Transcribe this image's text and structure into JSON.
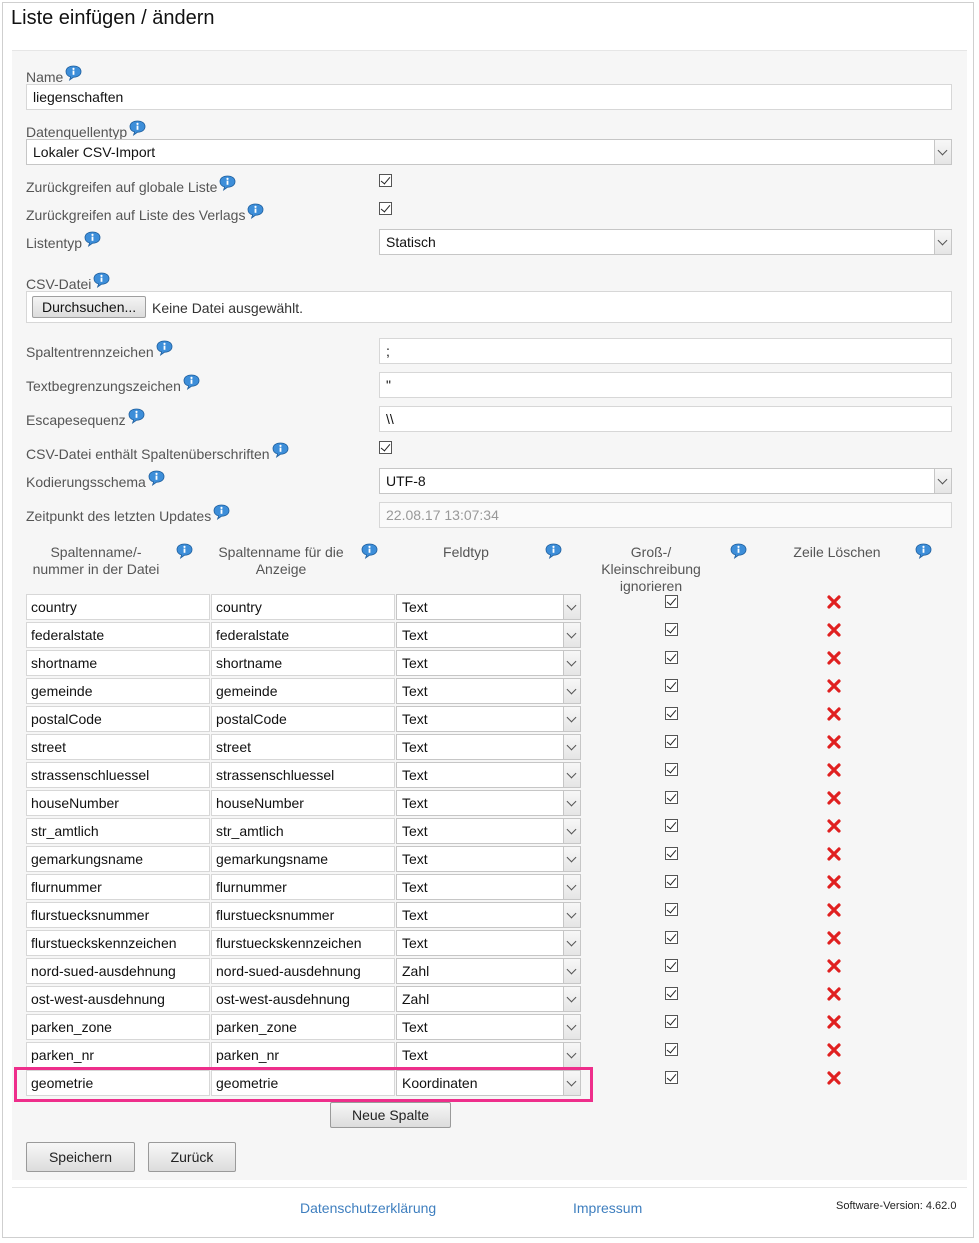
{
  "page": {
    "title": "Liste einfügen / ändern"
  },
  "form": {
    "name": {
      "label": "Name",
      "value": "liegenschaften"
    },
    "datasource_type": {
      "label": "Datenquellentyp",
      "value": "Lokaler CSV-Import"
    },
    "global_fallback": {
      "label": "Zurückgreifen auf globale Liste",
      "checked": true
    },
    "publisher_fallback": {
      "label": "Zurückgreifen auf Liste des Verlags",
      "checked": true
    },
    "list_type": {
      "label": "Listentyp",
      "value": "Statisch"
    },
    "csv_file": {
      "label": "CSV-Datei",
      "button": "Durchsuchen...",
      "status": "Keine Datei ausgewählt."
    },
    "column_separator": {
      "label": "Spaltentrennzeichen",
      "value": ";"
    },
    "text_delimiter": {
      "label": "Textbegrenzungszeichen",
      "value": "\""
    },
    "escape_sequence": {
      "label": "Escapesequenz",
      "value": "\\\\"
    },
    "has_headers": {
      "label": "CSV-Datei enthält Spaltenüberschriften",
      "checked": true
    },
    "encoding": {
      "label": "Kodierungsschema",
      "value": "UTF-8"
    },
    "last_update": {
      "label": "Zeitpunkt des letzten Updates",
      "value": "22.08.17 13:07:34"
    }
  },
  "columns_table": {
    "headers": {
      "source": "Spaltenname/-\nnummer in der Datei",
      "display": "Spaltenname für die\nAnzeige",
      "type": "Feldtyp",
      "ignore_case": "Groß-/\nKleinschreibung\nignorieren",
      "delete": "Zeile Löschen"
    },
    "rows": [
      {
        "source": "country",
        "display": "country",
        "type": "Text",
        "ignore_case": true
      },
      {
        "source": "federalstate",
        "display": "federalstate",
        "type": "Text",
        "ignore_case": true
      },
      {
        "source": "shortname",
        "display": "shortname",
        "type": "Text",
        "ignore_case": true
      },
      {
        "source": "gemeinde",
        "display": "gemeinde",
        "type": "Text",
        "ignore_case": true
      },
      {
        "source": "postalCode",
        "display": "postalCode",
        "type": "Text",
        "ignore_case": true
      },
      {
        "source": "street",
        "display": "street",
        "type": "Text",
        "ignore_case": true
      },
      {
        "source": "strassenschluessel",
        "display": "strassenschluessel",
        "type": "Text",
        "ignore_case": true
      },
      {
        "source": "houseNumber",
        "display": "houseNumber",
        "type": "Text",
        "ignore_case": true
      },
      {
        "source": "str_amtlich",
        "display": "str_amtlich",
        "type": "Text",
        "ignore_case": true
      },
      {
        "source": "gemarkungsname",
        "display": "gemarkungsname",
        "type": "Text",
        "ignore_case": true
      },
      {
        "source": "flurnummer",
        "display": "flurnummer",
        "type": "Text",
        "ignore_case": true
      },
      {
        "source": "flurstuecksnummer",
        "display": "flurstuecksnummer",
        "type": "Text",
        "ignore_case": true
      },
      {
        "source": "flurstueckskennzeichen",
        "display": "flurstueckskennzeichen",
        "type": "Text",
        "ignore_case": true
      },
      {
        "source": "nord-sued-ausdehnung",
        "display": "nord-sued-ausdehnung",
        "type": "Zahl",
        "ignore_case": true
      },
      {
        "source": "ost-west-ausdehnung",
        "display": "ost-west-ausdehnung",
        "type": "Zahl",
        "ignore_case": true
      },
      {
        "source": "parken_zone",
        "display": "parken_zone",
        "type": "Text",
        "ignore_case": true
      },
      {
        "source": "parken_nr",
        "display": "parken_nr",
        "type": "Text",
        "ignore_case": true
      },
      {
        "source": "geometrie",
        "display": "geometrie",
        "type": "Koordinaten",
        "ignore_case": true
      }
    ],
    "add_button": "Neue Spalte"
  },
  "actions": {
    "save": "Speichern",
    "back": "Zurück"
  },
  "footer": {
    "privacy": "Datenschutzerklärung",
    "imprint": "Impressum",
    "version": "Software-Version: 4.62.0"
  },
  "colors": {
    "highlight": "#ee2e8b",
    "link": "#3f7fbf",
    "delete": "#e02020"
  }
}
